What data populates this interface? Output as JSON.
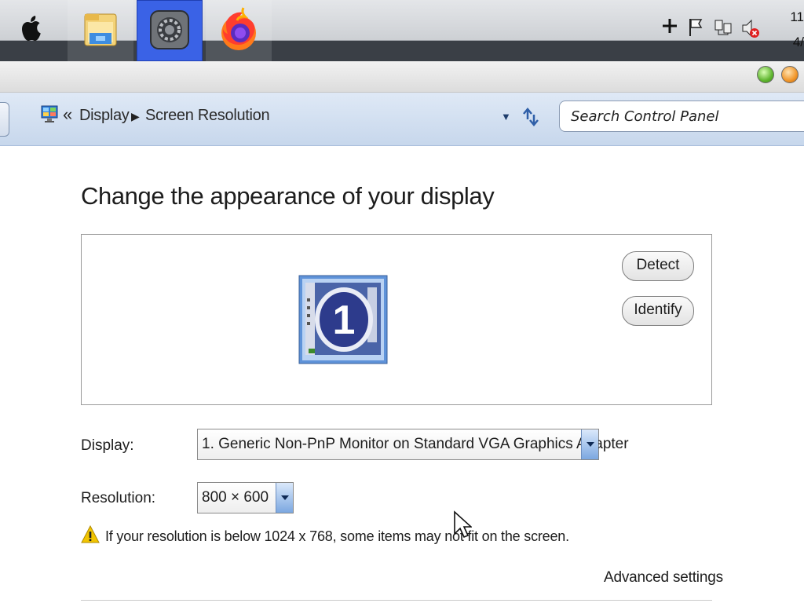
{
  "taskbar": {
    "apps": [
      {
        "name": "file-explorer"
      },
      {
        "name": "system-settings",
        "active": true
      },
      {
        "name": "firefox"
      }
    ],
    "clock": {
      "time": "11",
      "date": "4/"
    }
  },
  "address": {
    "overflow": "«",
    "crumbs": [
      "Display",
      "Screen Resolution"
    ],
    "search_placeholder": "Search Control Panel"
  },
  "content": {
    "title": "Change the appearance of your display",
    "monitor_number": "1",
    "detect_label": "Detect",
    "identify_label": "Identify",
    "display_label": "Display:",
    "display_value": "1. Generic Non-PnP Monitor on Standard VGA Graphics Adapter",
    "resolution_label": "Resolution:",
    "resolution_value": "800 × 600",
    "warning": "If your resolution is below 1024 x 768, some items may not fit on the screen.",
    "advanced_link": "Advanced settings"
  },
  "colors": {
    "active_task": "#3a62e6",
    "address_bar": "#d3e0f1",
    "warning": "#f2c500"
  }
}
